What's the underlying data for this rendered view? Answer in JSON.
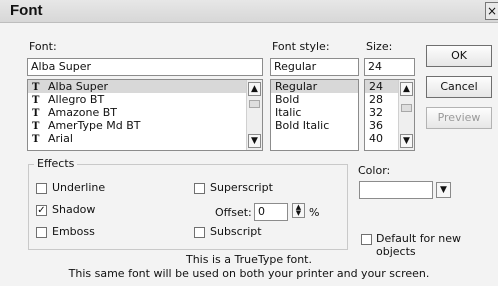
{
  "dialog": {
    "title": "Font"
  },
  "font": {
    "label": "Font:",
    "value": "Alba Super",
    "items": [
      "Alba Super",
      "Allegro BT",
      "Amazone BT",
      "AmerType Md BT",
      "Arial"
    ]
  },
  "style": {
    "label": "Font style:",
    "value": "Regular",
    "items": [
      "Regular",
      "Bold",
      "Italic",
      "Bold Italic"
    ]
  },
  "size": {
    "label": "Size:",
    "value": "24",
    "items": [
      "24",
      "28",
      "32",
      "36",
      "40"
    ]
  },
  "buttons": {
    "ok": "OK",
    "cancel": "Cancel",
    "preview": "Preview"
  },
  "effects": {
    "label": "Effects",
    "underline": "Underline",
    "shadow": "Shadow",
    "emboss": "Emboss",
    "superscript": "Superscript",
    "subscript": "Subscript",
    "offset_label": "Offset:",
    "offset_value": "0",
    "offset_unit": "%"
  },
  "color": {
    "label": "Color:"
  },
  "default_label": "Default for new objects",
  "footer": {
    "line1": "This is a TrueType font.",
    "line2": "This same font will be used on both your printer and your screen."
  }
}
